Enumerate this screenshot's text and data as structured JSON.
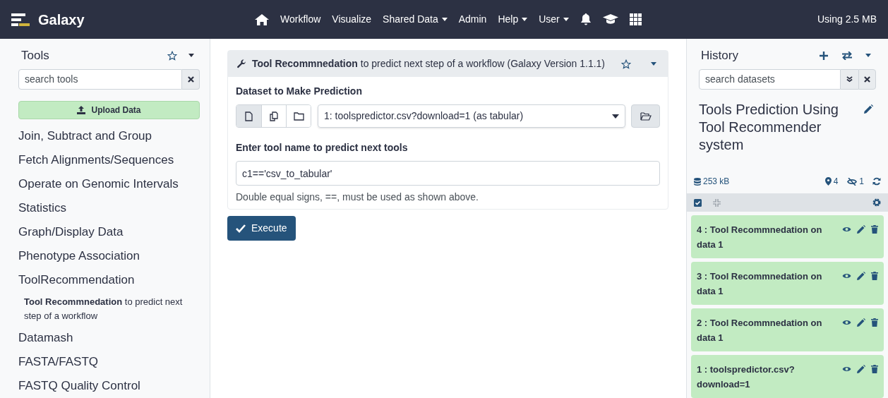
{
  "navbar": {
    "brand": "Galaxy",
    "links": [
      {
        "label": "Workflow",
        "dropdown": false
      },
      {
        "label": "Visualize",
        "dropdown": false
      },
      {
        "label": "Shared Data",
        "dropdown": true
      },
      {
        "label": "Admin",
        "dropdown": false
      },
      {
        "label": "Help",
        "dropdown": true
      },
      {
        "label": "User",
        "dropdown": true
      }
    ],
    "quota": "Using 2.5 MB"
  },
  "tool_panel": {
    "title": "Tools",
    "search": {
      "placeholder": "search tools"
    },
    "upload_button": "Upload Data",
    "sections": [
      {
        "label": "Join, Subtract and Group"
      },
      {
        "label": "Fetch Alignments/Sequences"
      },
      {
        "label": "Operate on Genomic Intervals"
      },
      {
        "label": "Statistics"
      },
      {
        "label": "Graph/Display Data"
      },
      {
        "label": "Phenotype Association"
      },
      {
        "label": "ToolRecommendation",
        "children": [
          {
            "label": "**Tool Recommnedation** to predict next step of a workflow"
          }
        ]
      },
      {
        "label": "Datamash"
      },
      {
        "label": "FASTA/FASTQ"
      },
      {
        "label": "FASTQ Quality Control"
      }
    ]
  },
  "tool_form": {
    "title": "**Tool Recommnedation** to predict next step of a workflow (Galaxy Version 1.1.1)",
    "dataset_field": {
      "label": "Dataset to Make Prediction",
      "sources": [
        {
          "selected": true
        },
        {
          "selected": false
        },
        {
          "selected": false
        }
      ],
      "value": "1: toolspredictor.csv?download=1 (as tabular)"
    },
    "tool_name_field": {
      "label": "Enter tool name to predict next tools",
      "value": "c1=='csv_to_tabular'",
      "help": "Double equal signs, ==, must be used as shown above."
    },
    "execute_button": "Execute"
  },
  "history": {
    "title": "History",
    "search": {
      "placeholder": "search datasets"
    },
    "name": "Tools Prediction Using Tool Recommender system",
    "size": "253 kB",
    "shown_count": "4",
    "hidden_count": "1",
    "datasets": [
      {
        "title": "4 : Tool Recommnedation on data 1"
      },
      {
        "title": "3 : Tool Recommnedation on data 1"
      },
      {
        "title": "2 : Tool Recommnedation on data 1"
      },
      {
        "title": "1 : toolspredictor.csv?download=1"
      }
    ]
  }
}
